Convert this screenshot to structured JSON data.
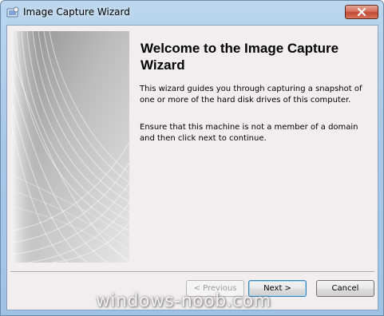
{
  "window": {
    "title": "Image Capture Wizard",
    "close_icon": "close-icon",
    "app_icon": "wizard-app-icon"
  },
  "content": {
    "heading": "Welcome to the Image Capture Wizard",
    "paragraph_1": "This wizard guides you through capturing a snapshot of one or more of the hard disk drives of this computer.",
    "paragraph_2": "Ensure that this machine is not a member of a domain and then click next to continue."
  },
  "buttons": {
    "previous": "< Previous",
    "next": "Next >",
    "cancel": "Cancel"
  },
  "watermark": "windows-noob.com",
  "colors": {
    "client_bg": "#f2eef0",
    "frame": "#a9c9e8",
    "close": "#c24a34"
  }
}
